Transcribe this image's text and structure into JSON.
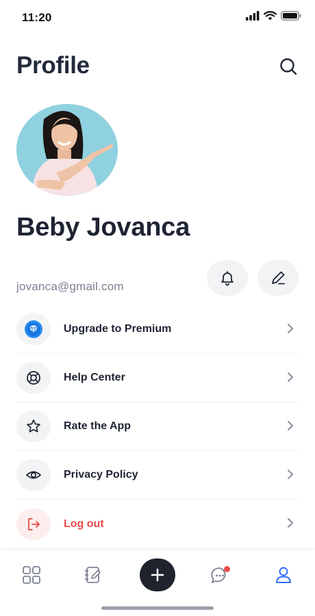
{
  "status_bar": {
    "time": "11:20"
  },
  "header": {
    "title": "Profile"
  },
  "profile": {
    "name": "Beby Jovanca",
    "email": "jovanca@gmail.com"
  },
  "menu": [
    {
      "label": "Upgrade to Premium",
      "icon": "premium-diamond-icon"
    },
    {
      "label": "Help Center",
      "icon": "lifebuoy-icon"
    },
    {
      "label": "Rate the App",
      "icon": "star-icon"
    },
    {
      "label": "Privacy Policy",
      "icon": "eye-icon"
    },
    {
      "label": "Log out",
      "icon": "logout-icon"
    }
  ],
  "bottom_nav": {
    "items": [
      "dashboard-icon",
      "notes-icon",
      "add-icon",
      "chat-icon",
      "profile-icon"
    ],
    "active": "profile-icon"
  },
  "colors": {
    "accent": "#2f6bff",
    "danger": "#ea4a4a",
    "dark": "#1f232d",
    "avatar_bg": "#8fd1de"
  }
}
